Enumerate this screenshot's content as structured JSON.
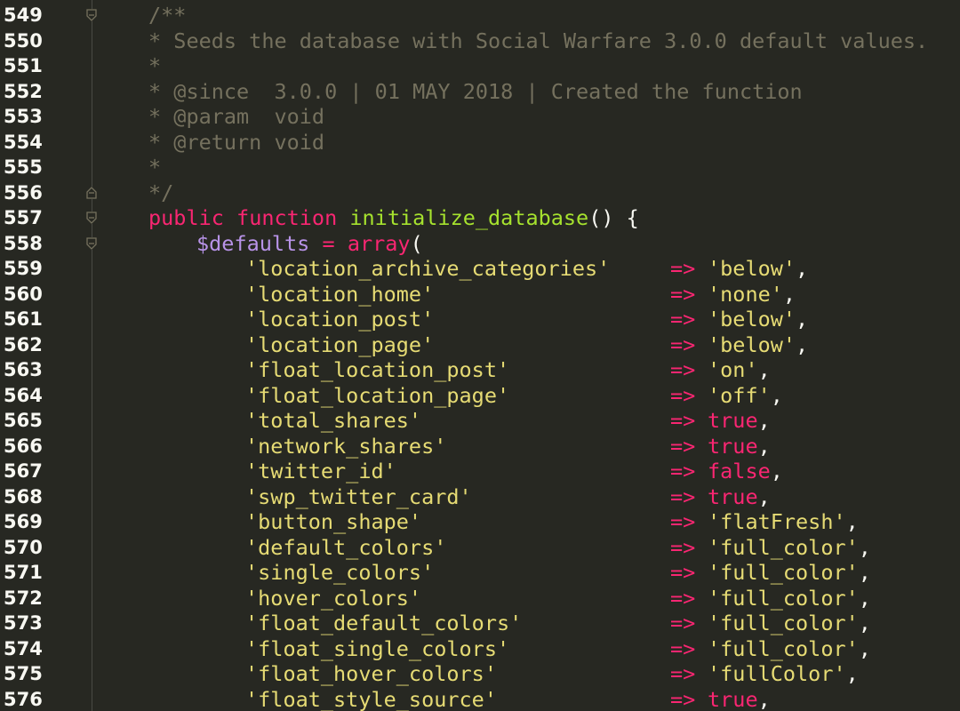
{
  "editor": {
    "lines": [
      {
        "num": "549",
        "kind": "comment",
        "text": "/**",
        "fold": "open"
      },
      {
        "num": "550",
        "kind": "comment",
        "text": "* Seeds the database with Social Warfare 3.0.0 default values."
      },
      {
        "num": "551",
        "kind": "comment",
        "text": "*"
      },
      {
        "num": "552",
        "kind": "comment",
        "text": "* @since  3.0.0 | 01 MAY 2018 | Created the function"
      },
      {
        "num": "553",
        "kind": "comment",
        "text": "* @param  void"
      },
      {
        "num": "554",
        "kind": "comment",
        "text": "* @return void"
      },
      {
        "num": "555",
        "kind": "comment",
        "text": "*"
      },
      {
        "num": "556",
        "kind": "comment",
        "text": "*/",
        "fold": "close"
      },
      {
        "num": "557",
        "kind": "function",
        "kw1": "public",
        "kw2": "function",
        "name": "initialize_database",
        "rest": "() {",
        "fold": "open"
      },
      {
        "num": "558",
        "kind": "assign",
        "var": "$defaults",
        "op": "=",
        "call": "array",
        "rest": "(",
        "fold": "open"
      }
    ],
    "entries": [
      {
        "num": "559",
        "key": "'location_archive_categories'",
        "value": "'below'",
        "type": "string"
      },
      {
        "num": "560",
        "key": "'location_home'",
        "value": "'none'",
        "type": "string"
      },
      {
        "num": "561",
        "key": "'location_post'",
        "value": "'below'",
        "type": "string"
      },
      {
        "num": "562",
        "key": "'location_page'",
        "value": "'below'",
        "type": "string"
      },
      {
        "num": "563",
        "key": "'float_location_post'",
        "value": "'on'",
        "type": "string"
      },
      {
        "num": "564",
        "key": "'float_location_page'",
        "value": "'off'",
        "type": "string"
      },
      {
        "num": "565",
        "key": "'total_shares'",
        "value": "true",
        "type": "bool"
      },
      {
        "num": "566",
        "key": "'network_shares'",
        "value": "true",
        "type": "bool"
      },
      {
        "num": "567",
        "key": "'twitter_id'",
        "value": "false",
        "type": "bool"
      },
      {
        "num": "568",
        "key": "'swp_twitter_card'",
        "value": "true",
        "type": "bool"
      },
      {
        "num": "569",
        "key": "'button_shape'",
        "value": "'flatFresh'",
        "type": "string"
      },
      {
        "num": "570",
        "key": "'default_colors'",
        "value": "'full_color'",
        "type": "string"
      },
      {
        "num": "571",
        "key": "'single_colors'",
        "value": "'full_color'",
        "type": "string"
      },
      {
        "num": "572",
        "key": "'hover_colors'",
        "value": "'full_color'",
        "type": "string"
      },
      {
        "num": "573",
        "key": "'float_default_colors'",
        "value": "'full_color'",
        "type": "string"
      },
      {
        "num": "574",
        "key": "'float_single_colors'",
        "value": "'full_color'",
        "type": "string"
      },
      {
        "num": "575",
        "key": "'float_hover_colors'",
        "value": "'fullColor'",
        "type": "string"
      },
      {
        "num": "576",
        "key": "'float_style_source'",
        "value": "true",
        "type": "bool"
      }
    ],
    "arrow": "=>",
    "comma": ","
  },
  "colors": {
    "background": "#272822",
    "comment": "#75715e",
    "keyword": "#f92672",
    "function": "#a6e22e",
    "variable": "#b893e8",
    "string": "#e6db74",
    "text": "#f8f8f2"
  }
}
